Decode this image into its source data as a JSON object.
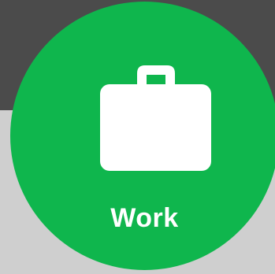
{
  "tile": {
    "label": "Work",
    "icon": "briefcase-icon",
    "color": "#0fb64d"
  },
  "background": {
    "top_color": "#4b4b4b",
    "bottom_color": "#cfcfcf"
  }
}
